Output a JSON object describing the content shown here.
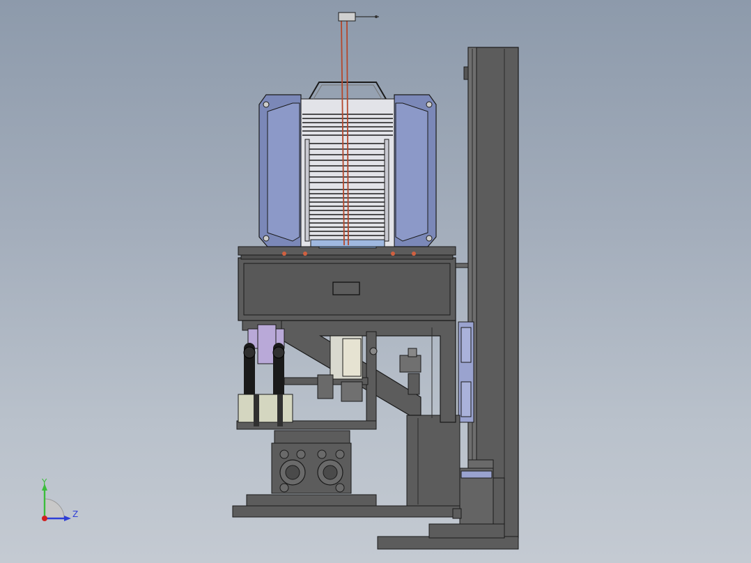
{
  "view": {
    "background_top": "#8d9aab",
    "background_bottom": "#c4cad2"
  },
  "model": {
    "frame_color": "#5f5f5f",
    "frame_edge_color": "#1f1f1f",
    "panel_color": "#8a97c4",
    "cassette_color": "#c7c8d0",
    "fixture_color": "#d4d6c0",
    "clamp_color": "#b9a9d8",
    "cable_color": "#b4482c"
  },
  "triad": {
    "y_label": "Y",
    "z_label": "Z",
    "y_color": "#3cbd3c",
    "z_color": "#2f3fd6",
    "x_color": "#d02020"
  }
}
